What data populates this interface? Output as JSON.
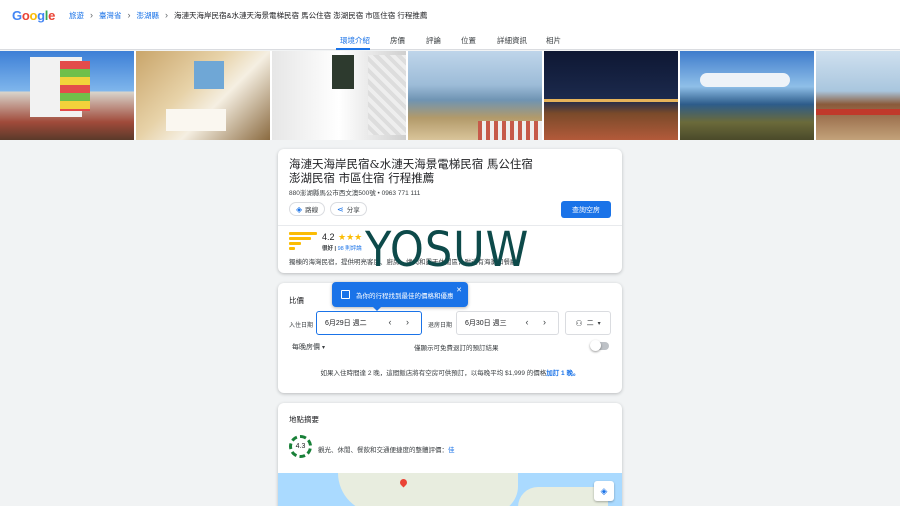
{
  "header": {
    "logo": [
      "G",
      "o",
      "o",
      "g",
      "l",
      "e"
    ],
    "breadcrumbs": [
      "旅遊",
      "臺灣省",
      "澎湖縣"
    ],
    "current": "海漣天海岸民宿&水漣天海景電梯民宿 馬公住宿 澎湖民宿 市區住宿 行程推薦"
  },
  "tabs": [
    "環境介紹",
    "房價",
    "評論",
    "位置",
    "詳細資訊",
    "相片"
  ],
  "hotel": {
    "title": "海漣天海岸民宿&水漣天海景電梯民宿 馬公住宿 澎湖民宿 市區住宿 行程推薦",
    "address": "880澎湖縣馬公市西文澳500號 • 0963 771 111",
    "route_label": "路線",
    "share_label": "分享",
    "check_label": "查詢空房",
    "rating": "4.2",
    "stars": "★★★",
    "rating_prefix": "很好 | ",
    "reviews": "98 則評論",
    "description": "獨棟的海灣民宿，提供明亮客房、廚房、烤肉和露天休閒區，附近有海灘和餐廳"
  },
  "watermark": "YOSUW",
  "price": {
    "heading": "比價",
    "tooltip": "為你的行程找到最佳的價格和優惠",
    "checkin_label": "入住日期",
    "checkin_value": "6月29日 週二",
    "checkout_label": "退房日期",
    "checkout_value": "6月30日 週三",
    "guests": "二",
    "per_night": "每晚房價",
    "free_cancel": "僅顯示可免費退訂的預訂結果",
    "note": "如果入住時間達 2 晚，這間飯店將有空房可供預訂，以每晚平均 $1,999 的價格",
    "note_link": "加訂 1 晚。"
  },
  "location": {
    "heading": "地點摘要",
    "score": "4.3",
    "desc": "觀光、休閒、餐飲和交通便捷度的整體評價：",
    "desc_link": "佳"
  },
  "colors": {
    "accent": "#1a73e8",
    "star": "#fbbc04",
    "good": "#188038"
  }
}
